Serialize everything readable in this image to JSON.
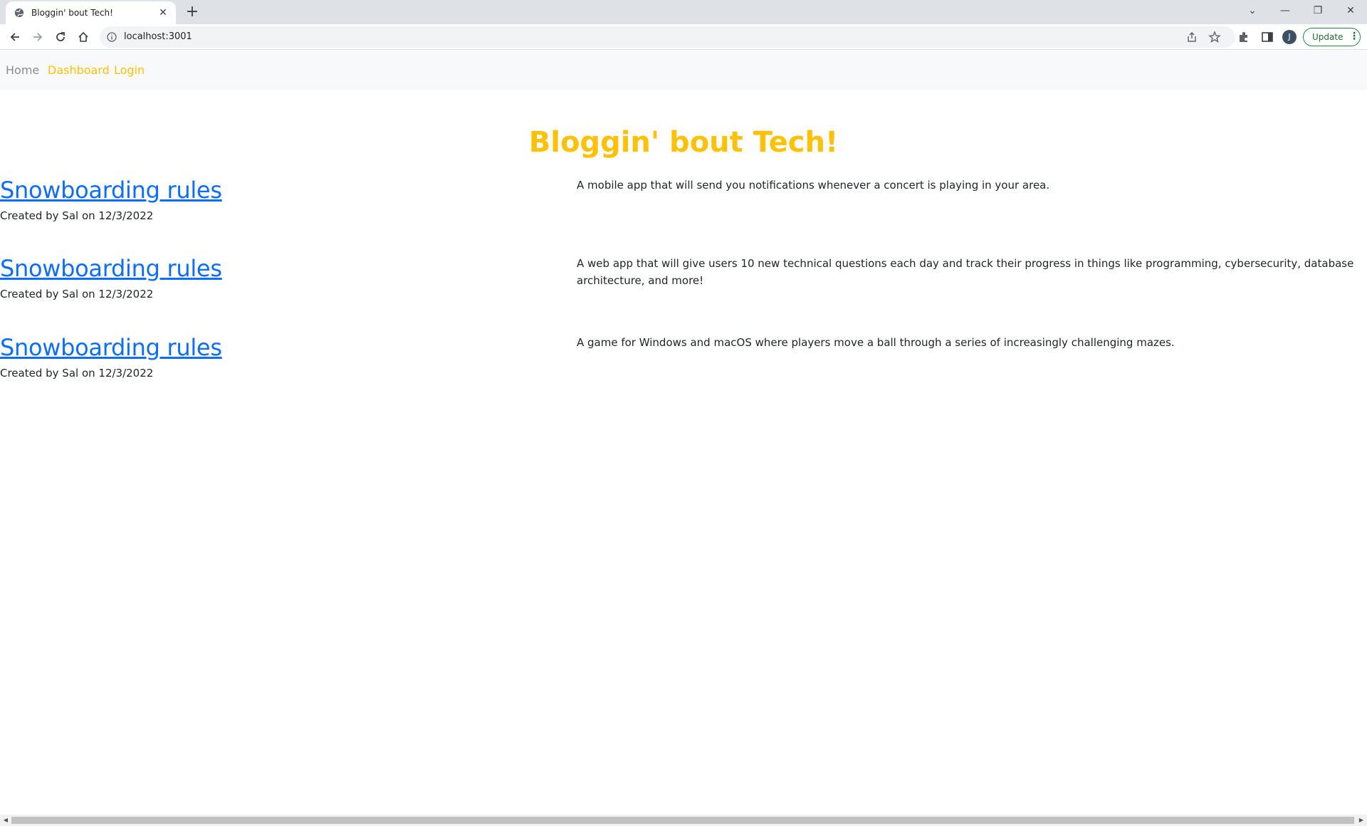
{
  "browser": {
    "tab_title": "Bloggin' bout Tech!",
    "tab_close": "✕",
    "new_tab": "+",
    "url": "localhost:3001",
    "profile_initial": "J",
    "update_label": "Update",
    "update_menu": "⋮",
    "window_controls": {
      "tab_search": "⌄",
      "minimize": "—",
      "restore": "❐",
      "close": "✕"
    },
    "scroll_left": "◀",
    "scroll_right": "▶"
  },
  "nav": {
    "home": "Home",
    "dashboard": "Dashboard",
    "login": "Login"
  },
  "site_title": "Bloggin' bout Tech!",
  "posts": [
    {
      "title": "Snowboarding rules",
      "meta": "Created by Sal on 12/3/2022",
      "description": "A mobile app that will send you notifications whenever a concert is playing in your area."
    },
    {
      "title": "Snowboarding rules",
      "meta": "Created by Sal on 12/3/2022",
      "description": "A web app that will give users 10 new technical questions each day and track their progress in things like programming, cybersecurity, database architecture, and more!"
    },
    {
      "title": "Snowboarding rules",
      "meta": "Created by Sal on 12/3/2022",
      "description": "A game for Windows and macOS where players move a ball through a series of increasingly challenging mazes."
    }
  ],
  "colors": {
    "accent": "#ffc107",
    "link": "#0d6efd",
    "nav_muted": "#8c8c8c",
    "text": "#212529"
  }
}
